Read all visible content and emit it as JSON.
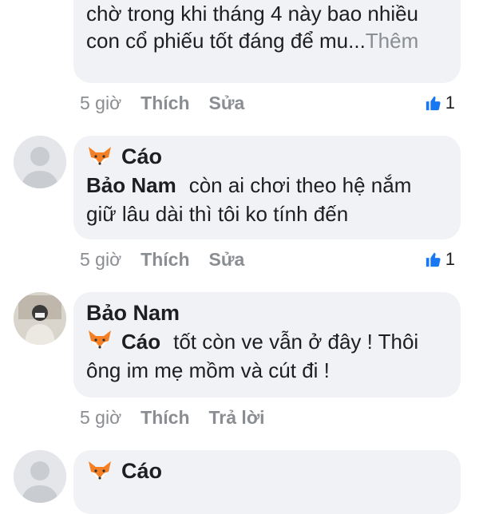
{
  "comments": [
    {
      "text_partial": "chờ trong khi tháng 4 này bao nhiều con cổ phiếu tốt đáng để mu...",
      "more_label": "Thêm",
      "time": "5 giờ",
      "like_label": "Thích",
      "second_action": "Sửa",
      "like_count": "1"
    },
    {
      "author": "Cáo",
      "mention": "Bảo Nam",
      "text": "còn ai chơi theo hệ nắm giữ lâu dài thì tôi ko tính đến",
      "time": "5 giờ",
      "like_label": "Thích",
      "second_action": "Sửa",
      "like_count": "1"
    },
    {
      "author": "Bảo Nam",
      "mention": "Cáo",
      "text": "tốt còn ve vẫn ở đây ! Thôi ông im mẹ mồm và cút đi !",
      "time": "5 giờ",
      "like_label": "Thích",
      "second_action": "Trả lời"
    },
    {
      "author": "Cáo"
    }
  ],
  "colors": {
    "bubble": "#f0f2f5",
    "meta_text": "#8a8d91",
    "like_blue": "#1877f2"
  },
  "icons": {
    "fox": "fox-emoji-icon",
    "like": "thumbs-up-icon",
    "avatar_placeholder": "default-person-icon"
  }
}
